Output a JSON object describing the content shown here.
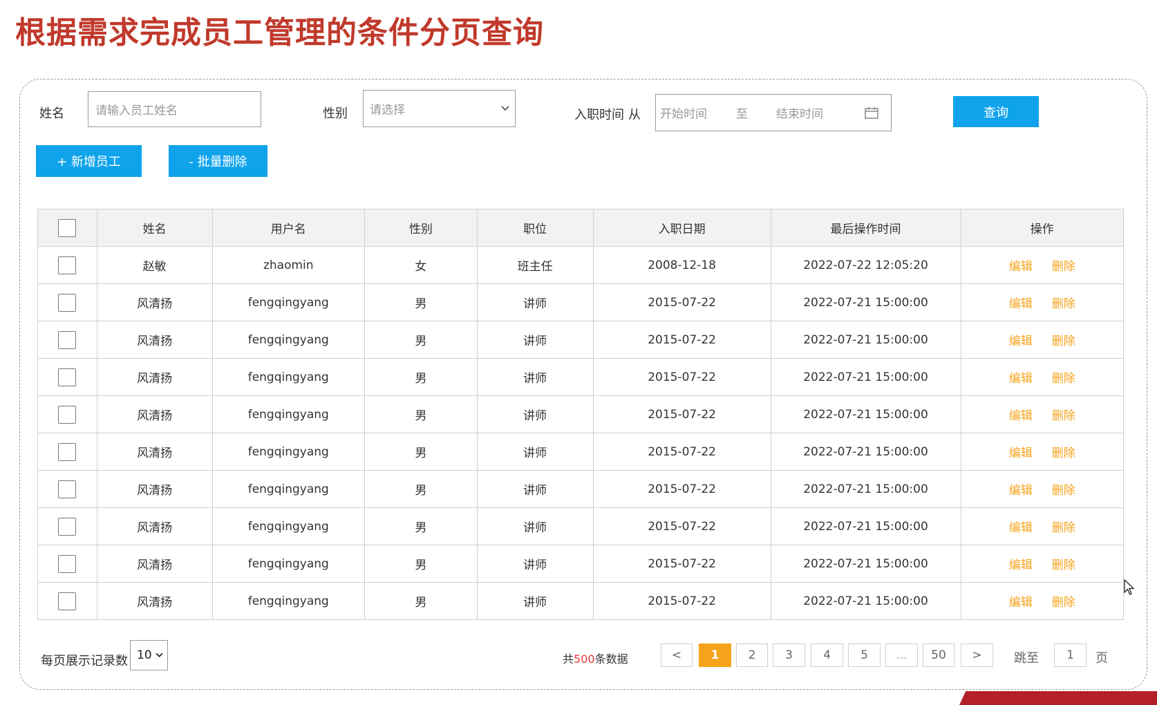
{
  "slide_title": "根据需求完成员工管理的条件分页查询",
  "filters": {
    "name_label": "姓名",
    "name_placeholder": "请输入员工姓名",
    "gender_label": "性别",
    "gender_placeholder": "请选择",
    "entry_label": "入职时间",
    "from_label": "从",
    "start_placeholder": "开始时间",
    "to_label": "至",
    "end_placeholder": "结束时间",
    "search_button": "查询"
  },
  "actions": {
    "add_button": "+ 新增员工",
    "batch_delete_button": "- 批量删除"
  },
  "table": {
    "columns": [
      "姓名",
      "用户名",
      "性别",
      "职位",
      "入职日期",
      "最后操作时间",
      "操作"
    ],
    "rows": [
      {
        "name": "赵敏",
        "username": "zhaomin",
        "gender": "女",
        "position": "班主任",
        "entry_date": "2008-12-18",
        "last_op": "2022-07-22 12:05:20"
      },
      {
        "name": "风清扬",
        "username": "fengqingyang",
        "gender": "男",
        "position": "讲师",
        "entry_date": "2015-07-22",
        "last_op": "2022-07-21 15:00:00"
      },
      {
        "name": "风清扬",
        "username": "fengqingyang",
        "gender": "男",
        "position": "讲师",
        "entry_date": "2015-07-22",
        "last_op": "2022-07-21 15:00:00"
      },
      {
        "name": "风清扬",
        "username": "fengqingyang",
        "gender": "男",
        "position": "讲师",
        "entry_date": "2015-07-22",
        "last_op": "2022-07-21 15:00:00"
      },
      {
        "name": "风清扬",
        "username": "fengqingyang",
        "gender": "男",
        "position": "讲师",
        "entry_date": "2015-07-22",
        "last_op": "2022-07-21 15:00:00"
      },
      {
        "name": "风清扬",
        "username": "fengqingyang",
        "gender": "男",
        "position": "讲师",
        "entry_date": "2015-07-22",
        "last_op": "2022-07-21 15:00:00"
      },
      {
        "name": "风清扬",
        "username": "fengqingyang",
        "gender": "男",
        "position": "讲师",
        "entry_date": "2015-07-22",
        "last_op": "2022-07-21 15:00:00"
      },
      {
        "name": "风清扬",
        "username": "fengqingyang",
        "gender": "男",
        "position": "讲师",
        "entry_date": "2015-07-22",
        "last_op": "2022-07-21 15:00:00"
      },
      {
        "name": "风清扬",
        "username": "fengqingyang",
        "gender": "男",
        "position": "讲师",
        "entry_date": "2015-07-22",
        "last_op": "2022-07-21 15:00:00"
      },
      {
        "name": "风清扬",
        "username": "fengqingyang",
        "gender": "男",
        "position": "讲师",
        "entry_date": "2015-07-22",
        "last_op": "2022-07-21 15:00:00"
      }
    ],
    "edit_label": "编辑",
    "delete_label": "删除"
  },
  "pagination": {
    "page_size_label": "每页展示记录数",
    "page_size_value": "10",
    "total_prefix": "共",
    "total_count": "500",
    "total_suffix": "条数据",
    "prev": "<",
    "pages": [
      "1",
      "2",
      "3",
      "4",
      "5",
      "...",
      "50"
    ],
    "current_page": "1",
    "next": ">",
    "jump_label": "跳至",
    "jump_value": "1",
    "page_unit": "页"
  },
  "colors": {
    "title": "#c0392b",
    "primary": "#0fa3eb",
    "action": "#f5a31a",
    "active_page": "#f5a31a",
    "total_count": "#e03c31"
  }
}
